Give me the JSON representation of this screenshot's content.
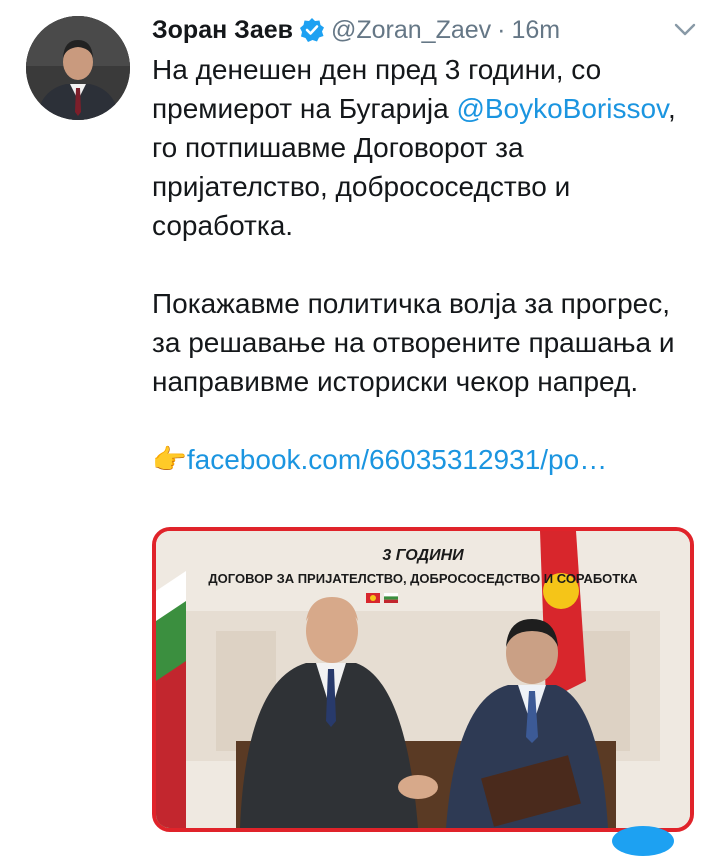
{
  "tweet": {
    "author_name": "Зоран Заев",
    "handle": "@Zoran_Zaev",
    "separator": "·",
    "time": "16m",
    "para1_before": "На денешен ден пред 3 години, со премиерот на Бугарија ",
    "mention": "@BoykoBorissov",
    "para1_after": ", го потпишавме Договорот за пријателство, добрососедство и соработка.",
    "para2": "Покажавме политичка волја за прогрес, за решавање на отворените прашања и направивме историски чекор напред.",
    "link_emoji": "👉",
    "link_text": "facebook.com/66035312931/po…"
  },
  "media": {
    "title_line1": "3 ГОДИНИ",
    "title_line2": "ДОГОВОР ЗА ПРИЈАТЕЛСТВО, ДОБРОСОСЕДСТВО И СОРАБОТКА",
    "border_color": "#e0232a"
  },
  "colors": {
    "link": "#1b95e0",
    "verified": "#1da1f2",
    "text": "#14171a",
    "muted": "#657786"
  },
  "icons": {
    "verified": "verified-badge-icon",
    "menu": "chevron-down-icon"
  }
}
